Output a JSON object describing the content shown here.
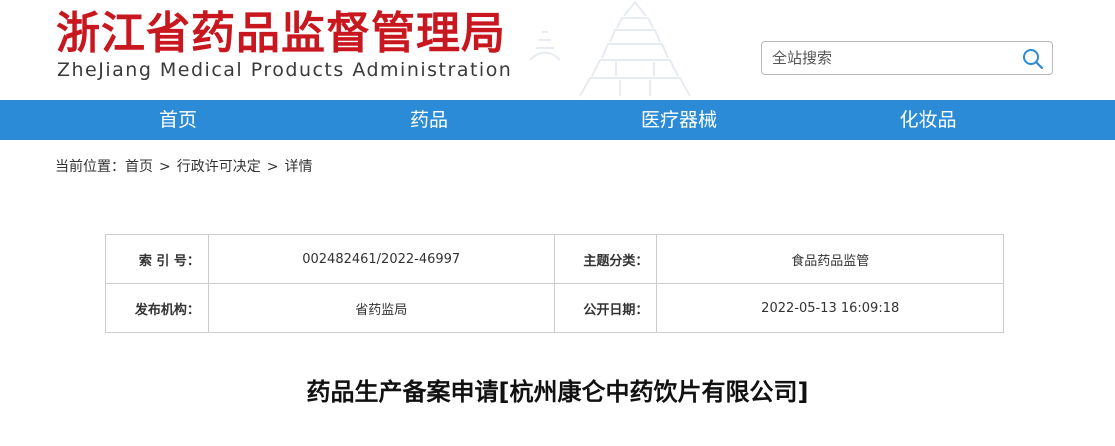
{
  "header": {
    "title_cn": "浙江省药品监督管理局",
    "title_en": "ZheJiang Medical Products Administration",
    "brand_color": "#c8171e"
  },
  "search": {
    "placeholder": "全站搜索",
    "value": "",
    "icon": "search-icon"
  },
  "nav": {
    "color": "#2b8bd6",
    "items": [
      {
        "label": "首页"
      },
      {
        "label": "药品"
      },
      {
        "label": "医疗器械"
      },
      {
        "label": "化妆品"
      }
    ]
  },
  "breadcrumb": {
    "prefix": "当前位置：",
    "items": [
      "首页",
      "行政许可决定",
      "详情"
    ],
    "separator": ">"
  },
  "meta": {
    "rows": [
      {
        "label1": "索 引 号：",
        "value1": "002482461/2022-46997",
        "label2": "主题分类：",
        "value2": "食品药品监管"
      },
      {
        "label1": "发布机构：",
        "value1": "省药监局",
        "label2": "公开日期：",
        "value2": "2022-05-13 16:09:18"
      }
    ]
  },
  "article": {
    "title": "药品生产备案申请[杭州康仑中药饮片有限公司]"
  }
}
